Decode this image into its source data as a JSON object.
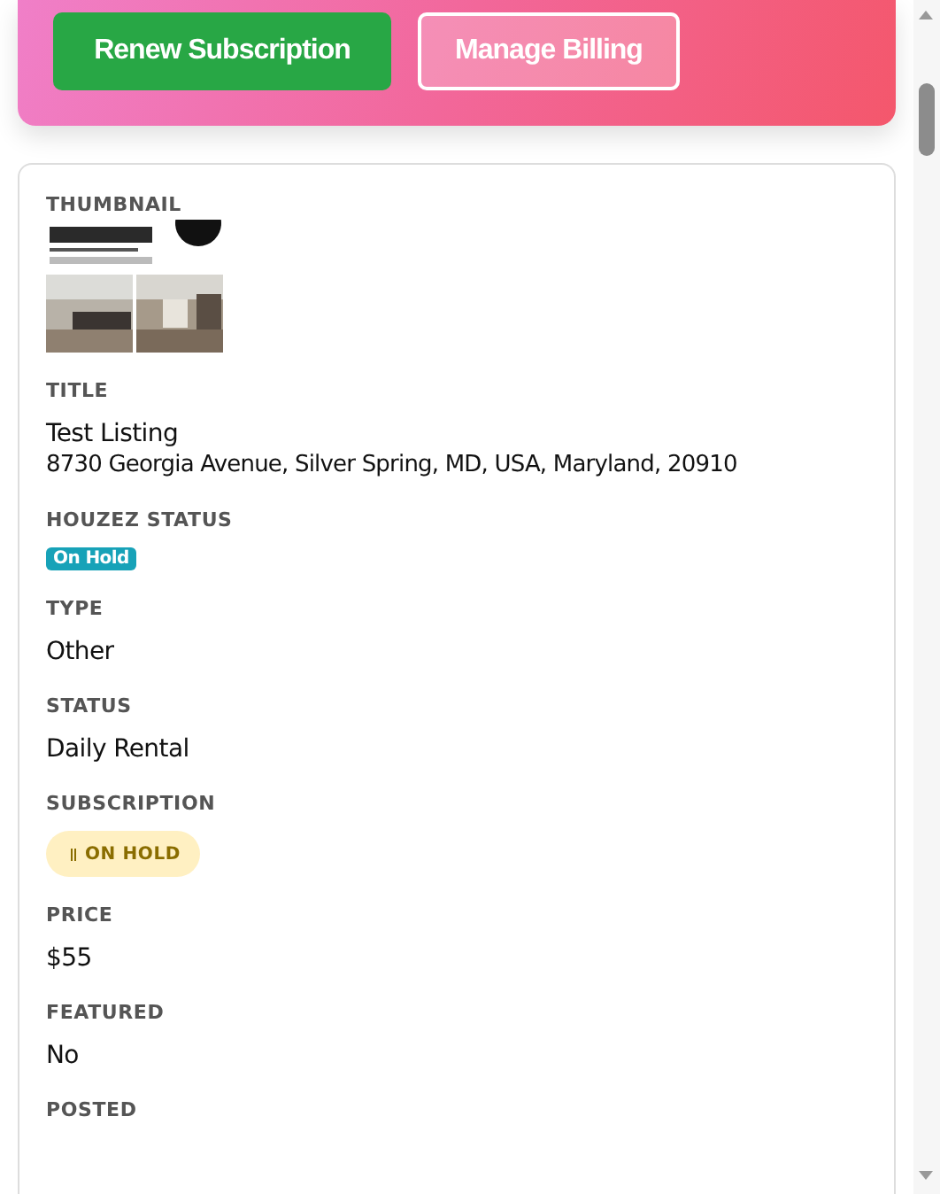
{
  "header": {
    "buttons": [
      {
        "label": "Renew Subscription",
        "kind": "primary"
      },
      {
        "label": "Manage Billing",
        "kind": "outline"
      }
    ]
  },
  "fields": [
    {
      "label": "THUMBNAIL",
      "kind": "picture"
    },
    {
      "label": "TITLE",
      "kind": "text",
      "lines": [
        "Test Listing",
        "8730 Georgia Avenue, Silver Spring, MD, USA, Maryland, 20910"
      ]
    },
    {
      "label": "HOUZEZ STATUS",
      "kind": "badge",
      "value": "On Hold"
    },
    {
      "label": "TYPE",
      "kind": "text",
      "lines": [
        "Other"
      ]
    },
    {
      "label": "STATUS",
      "kind": "text",
      "lines": [
        "Daily Rental"
      ]
    },
    {
      "label": "SUBSCRIPTION",
      "kind": "pill",
      "value": "ON HOLD"
    },
    {
      "label": "PRICE",
      "kind": "text",
      "lines": [
        "$55"
      ]
    },
    {
      "label": "FEATURED",
      "kind": "text",
      "lines": [
        "No"
      ]
    },
    {
      "label": "POSTED",
      "kind": "none"
    }
  ]
}
